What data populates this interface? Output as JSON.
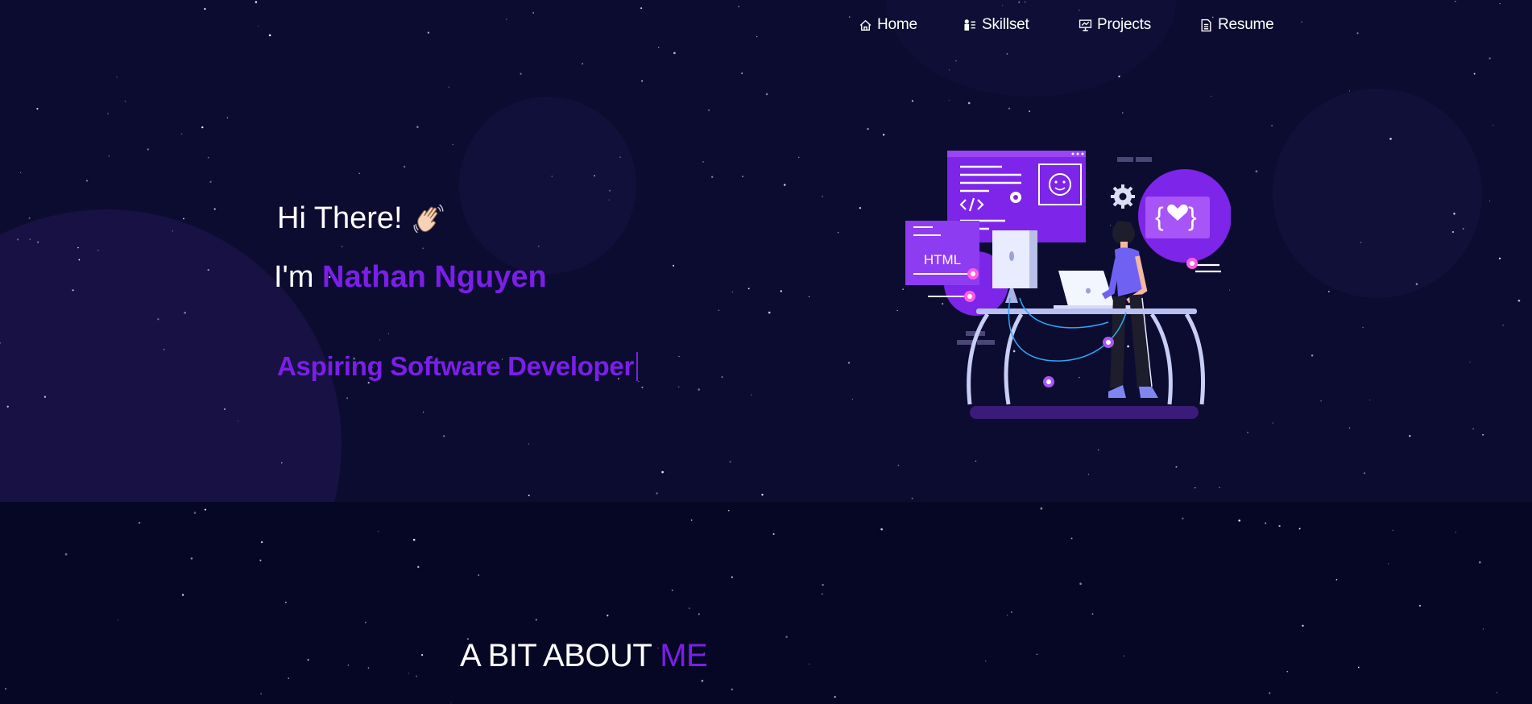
{
  "nav": {
    "items": [
      {
        "label": "Home",
        "icon": "home-icon"
      },
      {
        "label": "Skillset",
        "icon": "person-list-icon"
      },
      {
        "label": "Projects",
        "icon": "presentation-icon"
      },
      {
        "label": "Resume",
        "icon": "document-icon"
      }
    ]
  },
  "hero": {
    "greeting": "Hi There!",
    "wave_icon": "waving-hand-icon",
    "intro_prefix": "I'm",
    "name": "Nathan Nguyen",
    "role": "Aspiring Software Developer",
    "illustration_label": "HTML"
  },
  "about": {
    "heading_main": "A BIT ABOUT",
    "heading_accent": "ME"
  },
  "colors": {
    "background": "#0c0c31",
    "accent": "#7b1fe8",
    "text": "#ffffff"
  }
}
